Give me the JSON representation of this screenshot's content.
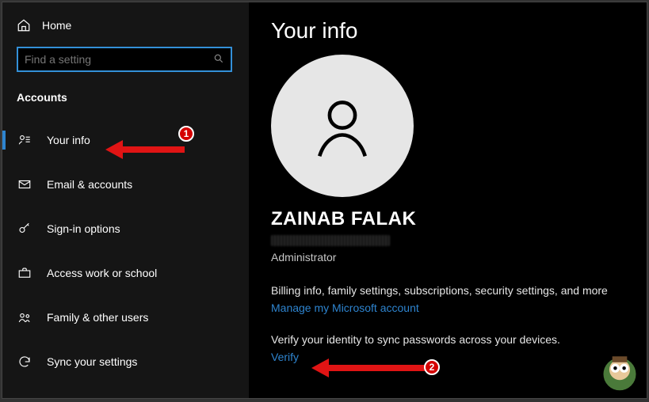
{
  "sidebar": {
    "home": "Home",
    "search_placeholder": "Find a setting",
    "section": "Accounts",
    "items": [
      {
        "label": "Your info"
      },
      {
        "label": "Email & accounts"
      },
      {
        "label": "Sign-in options"
      },
      {
        "label": "Access work or school"
      },
      {
        "label": "Family & other users"
      },
      {
        "label": "Sync your settings"
      }
    ]
  },
  "main": {
    "title": "Your info",
    "user_name": "ZAINAB FALAK",
    "role": "Administrator",
    "billing_desc": "Billing info, family settings, subscriptions, security settings, and more",
    "manage_link": "Manage my Microsoft account",
    "verify_desc": "Verify your identity to sync passwords across your devices.",
    "verify_link": "Verify"
  },
  "annotations": {
    "step1": "1",
    "step2": "2"
  },
  "colors": {
    "accent": "#2e84cf",
    "annotation": "#e01414"
  }
}
